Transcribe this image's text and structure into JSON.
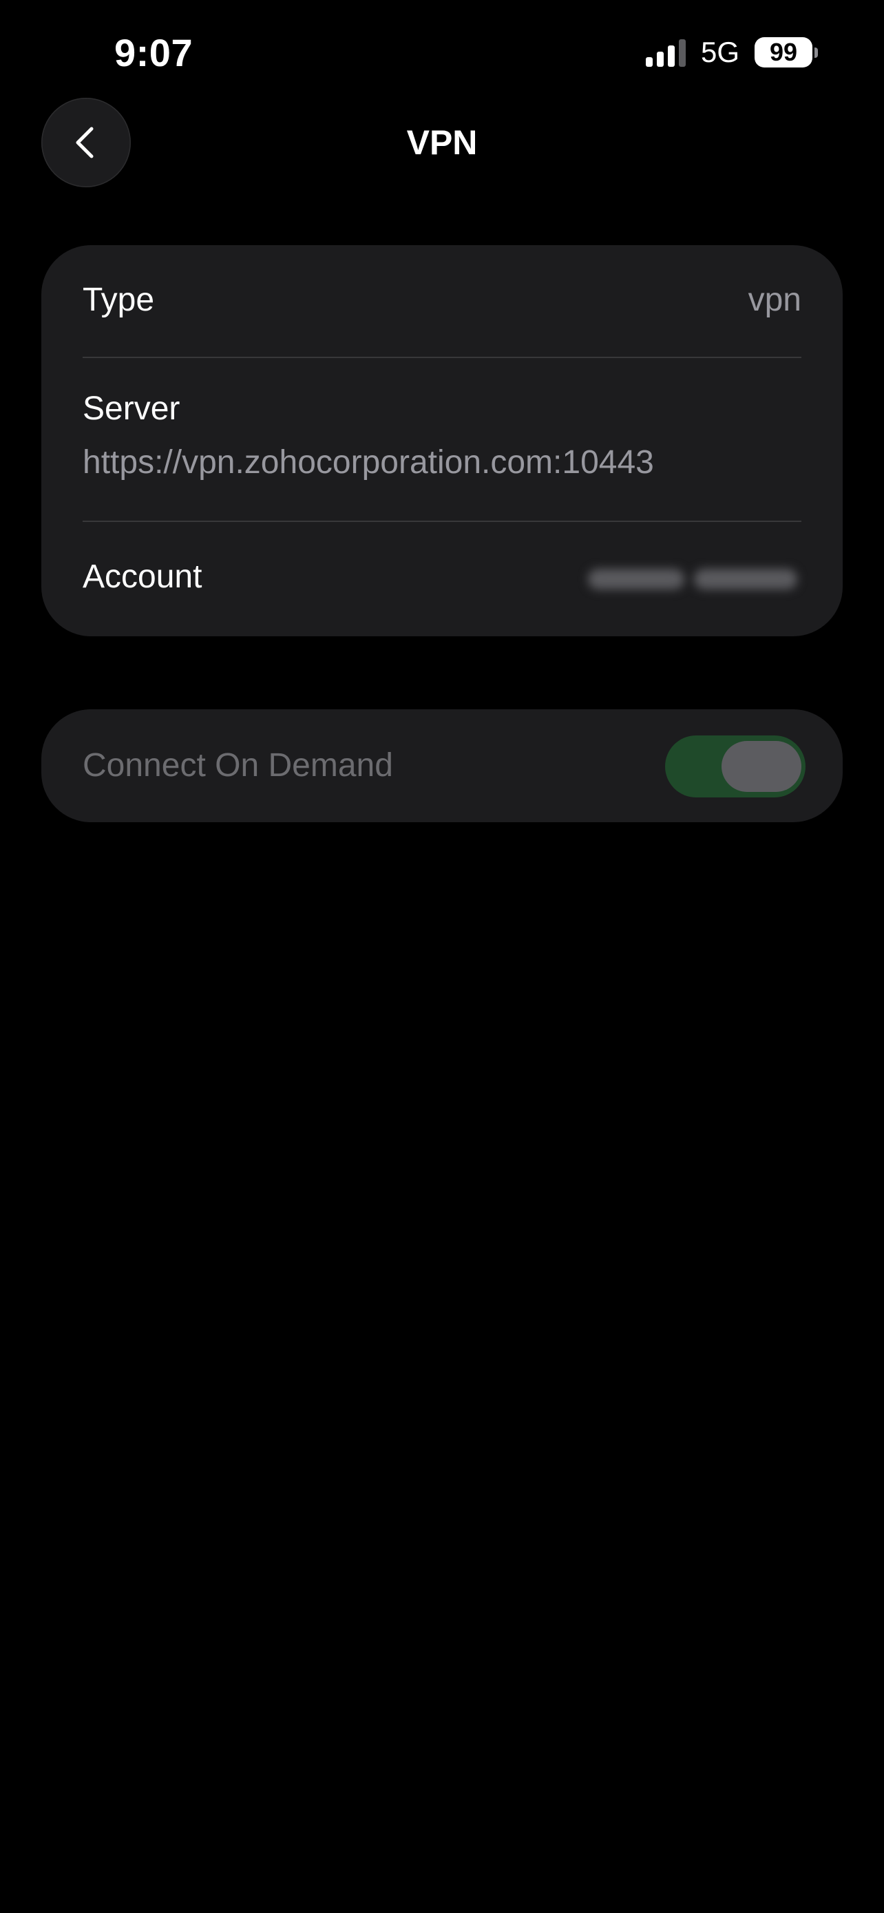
{
  "status_bar": {
    "time": "9:07",
    "network": "5G",
    "battery": "99"
  },
  "nav": {
    "title": "VPN",
    "back_icon": "chevron-left-icon"
  },
  "details": {
    "type_label": "Type",
    "type_value": "vpn",
    "server_label": "Server",
    "server_value": "https://vpn.zohocorporation.com:10443",
    "account_label": "Account"
  },
  "connect_on_demand": {
    "label": "Connect On Demand",
    "enabled": true,
    "toggle_color": "#1f4a2a"
  }
}
